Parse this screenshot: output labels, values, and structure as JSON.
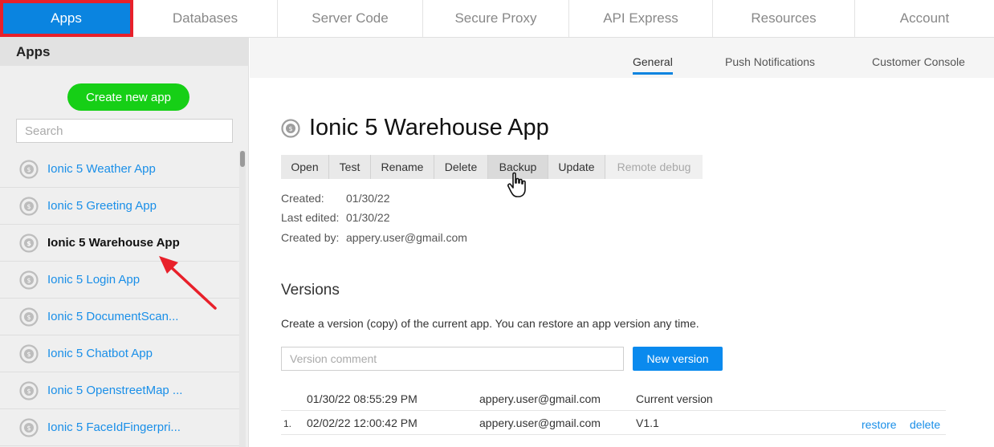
{
  "topnav": {
    "tabs": [
      {
        "label": "Apps",
        "active": true
      },
      {
        "label": "Databases"
      },
      {
        "label": "Server Code"
      },
      {
        "label": "Secure Proxy"
      },
      {
        "label": "API Express"
      },
      {
        "label": "Resources"
      },
      {
        "label": "Account"
      }
    ]
  },
  "sidebar": {
    "title": "Apps",
    "create_label": "Create new app",
    "search_placeholder": "Search",
    "app_icon": "ionic-app-icon",
    "apps": [
      {
        "label": "Ionic 5 Weather App"
      },
      {
        "label": "Ionic 5 Greeting App"
      },
      {
        "label": "Ionic 5 Warehouse App",
        "selected": true
      },
      {
        "label": "Ionic 5 Login App"
      },
      {
        "label": "Ionic 5 DocumentScan..."
      },
      {
        "label": "Ionic 5 Chatbot App"
      },
      {
        "label": "Ionic 5 OpenstreetMap ..."
      },
      {
        "label": "Ionic 5 FaceIdFingerpri..."
      }
    ]
  },
  "subtabs": [
    {
      "label": "General",
      "active": true
    },
    {
      "label": "Push Notifications"
    },
    {
      "label": "Customer Console"
    }
  ],
  "app": {
    "title": "Ionic 5 Warehouse App",
    "toolbar": {
      "open": "Open",
      "test": "Test",
      "rename": "Rename",
      "delete": "Delete",
      "backup": "Backup",
      "update": "Update",
      "remote_debug": "Remote debug"
    },
    "meta": {
      "created_label": "Created:",
      "created_value": "01/30/22",
      "edited_label": "Last edited:",
      "edited_value": "01/30/22",
      "by_label": "Created by:",
      "by_value": "appery.user@gmail.com"
    }
  },
  "versions": {
    "title": "Versions",
    "description": "Create a version (copy) of the current app. You can restore an app version any time.",
    "comment_placeholder": "Version comment",
    "new_label": "New version",
    "rows": [
      {
        "num": "",
        "date": "01/30/22 08:55:29 PM",
        "user": "appery.user@gmail.com",
        "version": "Current version"
      },
      {
        "num": "1.",
        "date": "02/02/22 12:00:42 PM",
        "user": "appery.user@gmail.com",
        "version": "V1.1",
        "restore": "restore",
        "delete": "delete"
      }
    ]
  },
  "colors": {
    "accent": "#0a84e0",
    "create": "#16cf16",
    "link": "#1a8fe8",
    "annotation": "#e8202a"
  }
}
